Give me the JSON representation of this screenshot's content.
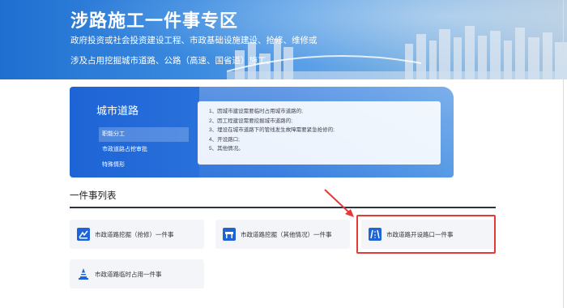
{
  "banner": {
    "title": "涉路施工一件事专区",
    "subtitle_line1": "政府投资或社会投资建设工程、市政基础设施建设、抢修、维修或",
    "subtitle_line2": "涉及占用挖掘城市道路、公路（高速、国省道）施工。"
  },
  "road_panel": {
    "title": "城市道路",
    "menu": [
      {
        "label": "职能分工",
        "active": true
      },
      {
        "label": "市政道路占挖审批",
        "active": false
      },
      {
        "label": "特殊情形",
        "active": false
      }
    ],
    "description": [
      "1、因城市建设需要临时占用城市道路的;",
      "2、因工程建设需要挖掘城市道路的;",
      "3、埋设在城市道路下的管线发生故障需要紧急抢修的;",
      "4、开设路口;",
      "5、其他情况。"
    ]
  },
  "section": {
    "title": "一件事列表"
  },
  "cards": [
    {
      "label": "市政道路挖掘（抢修）一件事",
      "icon": "excavation-icon"
    },
    {
      "label": "市政道路挖掘（其他情况）一件事",
      "icon": "barrier-icon"
    },
    {
      "label": "市政道路开设路口一件事",
      "icon": "road-icon"
    },
    {
      "label": "市政道路临时占用一件事",
      "icon": "traffic-cone-icon"
    }
  ],
  "colors": {
    "accent": "#1e64d6",
    "highlight": "#e53935",
    "card_bg": "#f3f5f8"
  }
}
